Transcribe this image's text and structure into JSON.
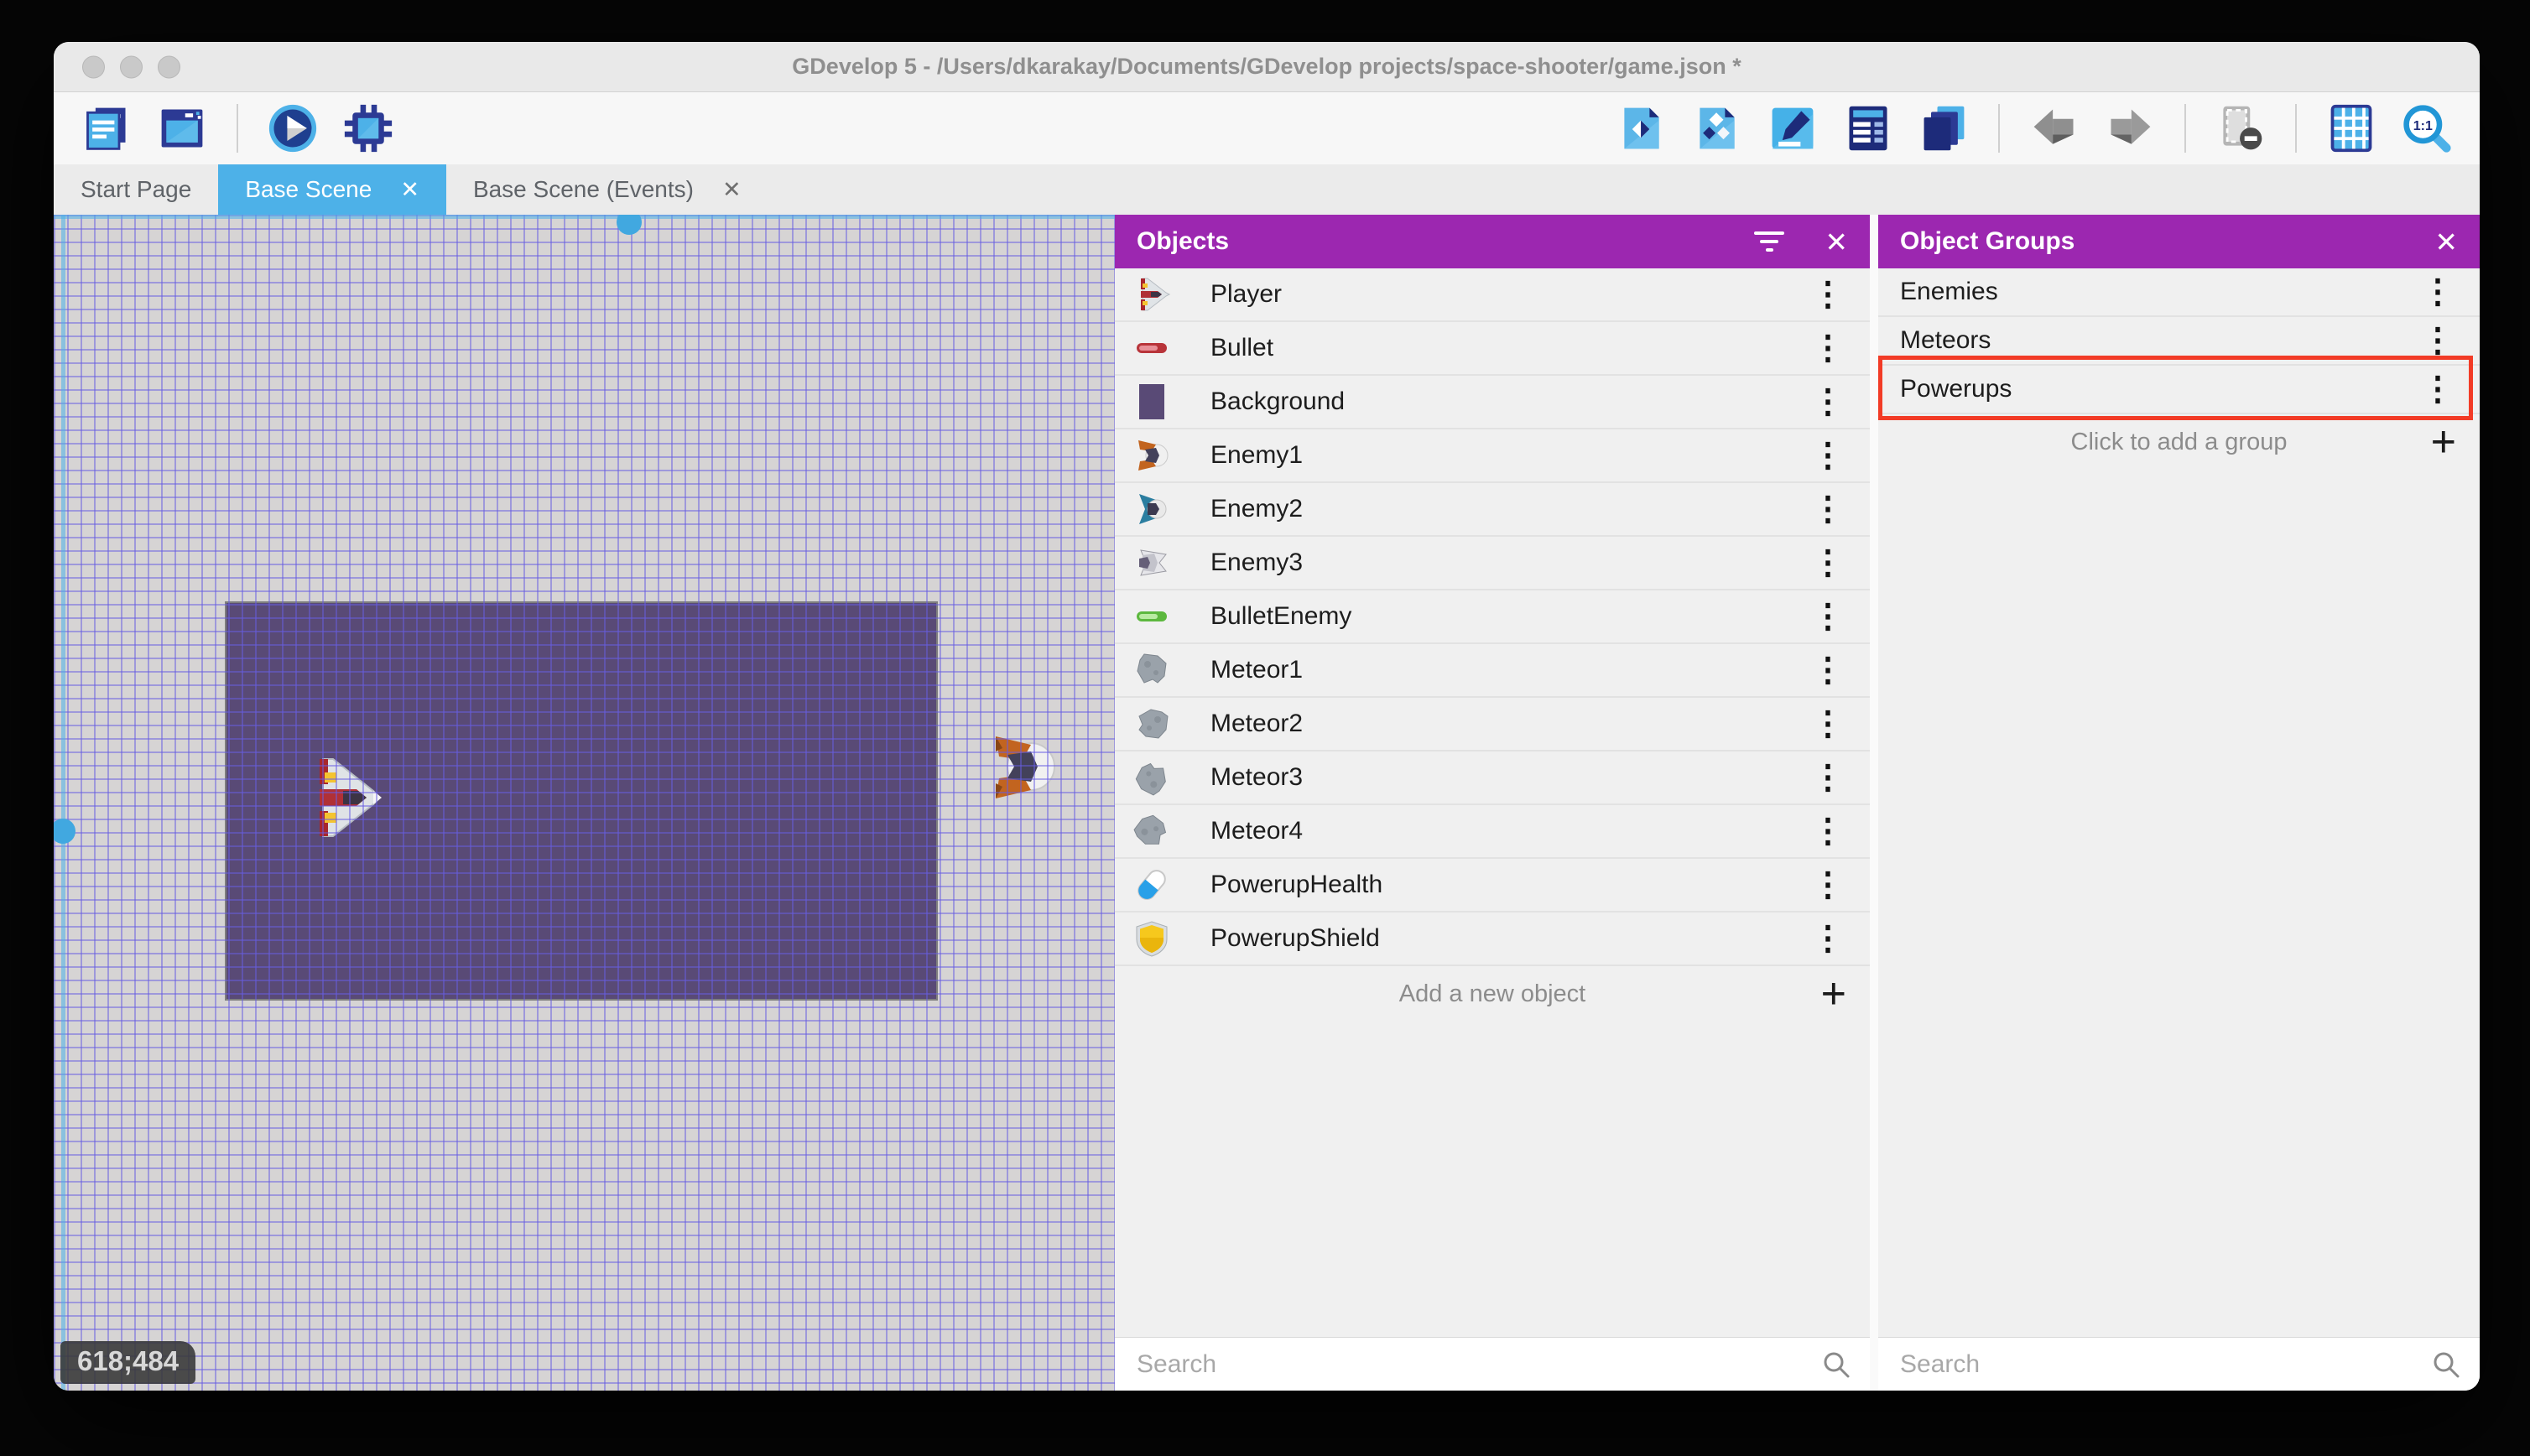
{
  "window": {
    "title": "GDevelop 5 - /Users/dkarakay/Documents/GDevelop projects/space-shooter/game.json *",
    "traffic_lights": [
      "close",
      "minimize",
      "zoom"
    ]
  },
  "toolbar": {
    "left_icons": [
      "project-manager-icon",
      "scene-window-icon",
      "play-icon",
      "debug-icon"
    ],
    "right_icons": [
      "add-object-icon",
      "add-multiple-objects-icon",
      "edit-scene-icon",
      "instances-list-icon",
      "layers-icon",
      "undo-icon",
      "redo-icon",
      "mask-icon",
      "grid-icon",
      "zoom-1-1-icon"
    ],
    "zoom_icon_label": "1:1"
  },
  "tabs": [
    {
      "label": "Start Page",
      "active": false,
      "closable": false
    },
    {
      "label": "Base Scene",
      "active": true,
      "closable": true
    },
    {
      "label": "Base Scene (Events)",
      "active": false,
      "closable": true
    }
  ],
  "canvas": {
    "coordinates": "618;484",
    "background_object_color": "#594a76"
  },
  "objects_panel": {
    "title": "Objects",
    "items": [
      {
        "name": "Player",
        "thumb": "player-ship"
      },
      {
        "name": "Bullet",
        "thumb": "red-bullet"
      },
      {
        "name": "Background",
        "thumb": "purple-rectangle"
      },
      {
        "name": "Enemy1",
        "thumb": "orange-enemy-ship"
      },
      {
        "name": "Enemy2",
        "thumb": "teal-enemy-ship"
      },
      {
        "name": "Enemy3",
        "thumb": "gray-enemy-ship"
      },
      {
        "name": "BulletEnemy",
        "thumb": "green-bullet"
      },
      {
        "name": "Meteor1",
        "thumb": "meteor-rock"
      },
      {
        "name": "Meteor2",
        "thumb": "meteor-rock"
      },
      {
        "name": "Meteor3",
        "thumb": "meteor-rock"
      },
      {
        "name": "Meteor4",
        "thumb": "meteor-rock"
      },
      {
        "name": "PowerupHealth",
        "thumb": "health-pill"
      },
      {
        "name": "PowerupShield",
        "thumb": "yellow-shield"
      }
    ],
    "add_label": "Add a new object",
    "search_placeholder": "Search"
  },
  "groups_panel": {
    "title": "Object Groups",
    "items": [
      {
        "name": "Enemies",
        "highlighted": false
      },
      {
        "name": "Meteors",
        "highlighted": false
      },
      {
        "name": "Powerups",
        "highlighted": true
      }
    ],
    "add_label": "Click to add a group",
    "search_placeholder": "Search"
  },
  "glyphs": {
    "close": "✕",
    "menu": "⋮",
    "plus": "+"
  },
  "colors": {
    "accent_blue": "#4db1e8",
    "panel_purple": "#9c27b0",
    "highlight_red": "#f23b26",
    "grid_line": "#675de2"
  }
}
